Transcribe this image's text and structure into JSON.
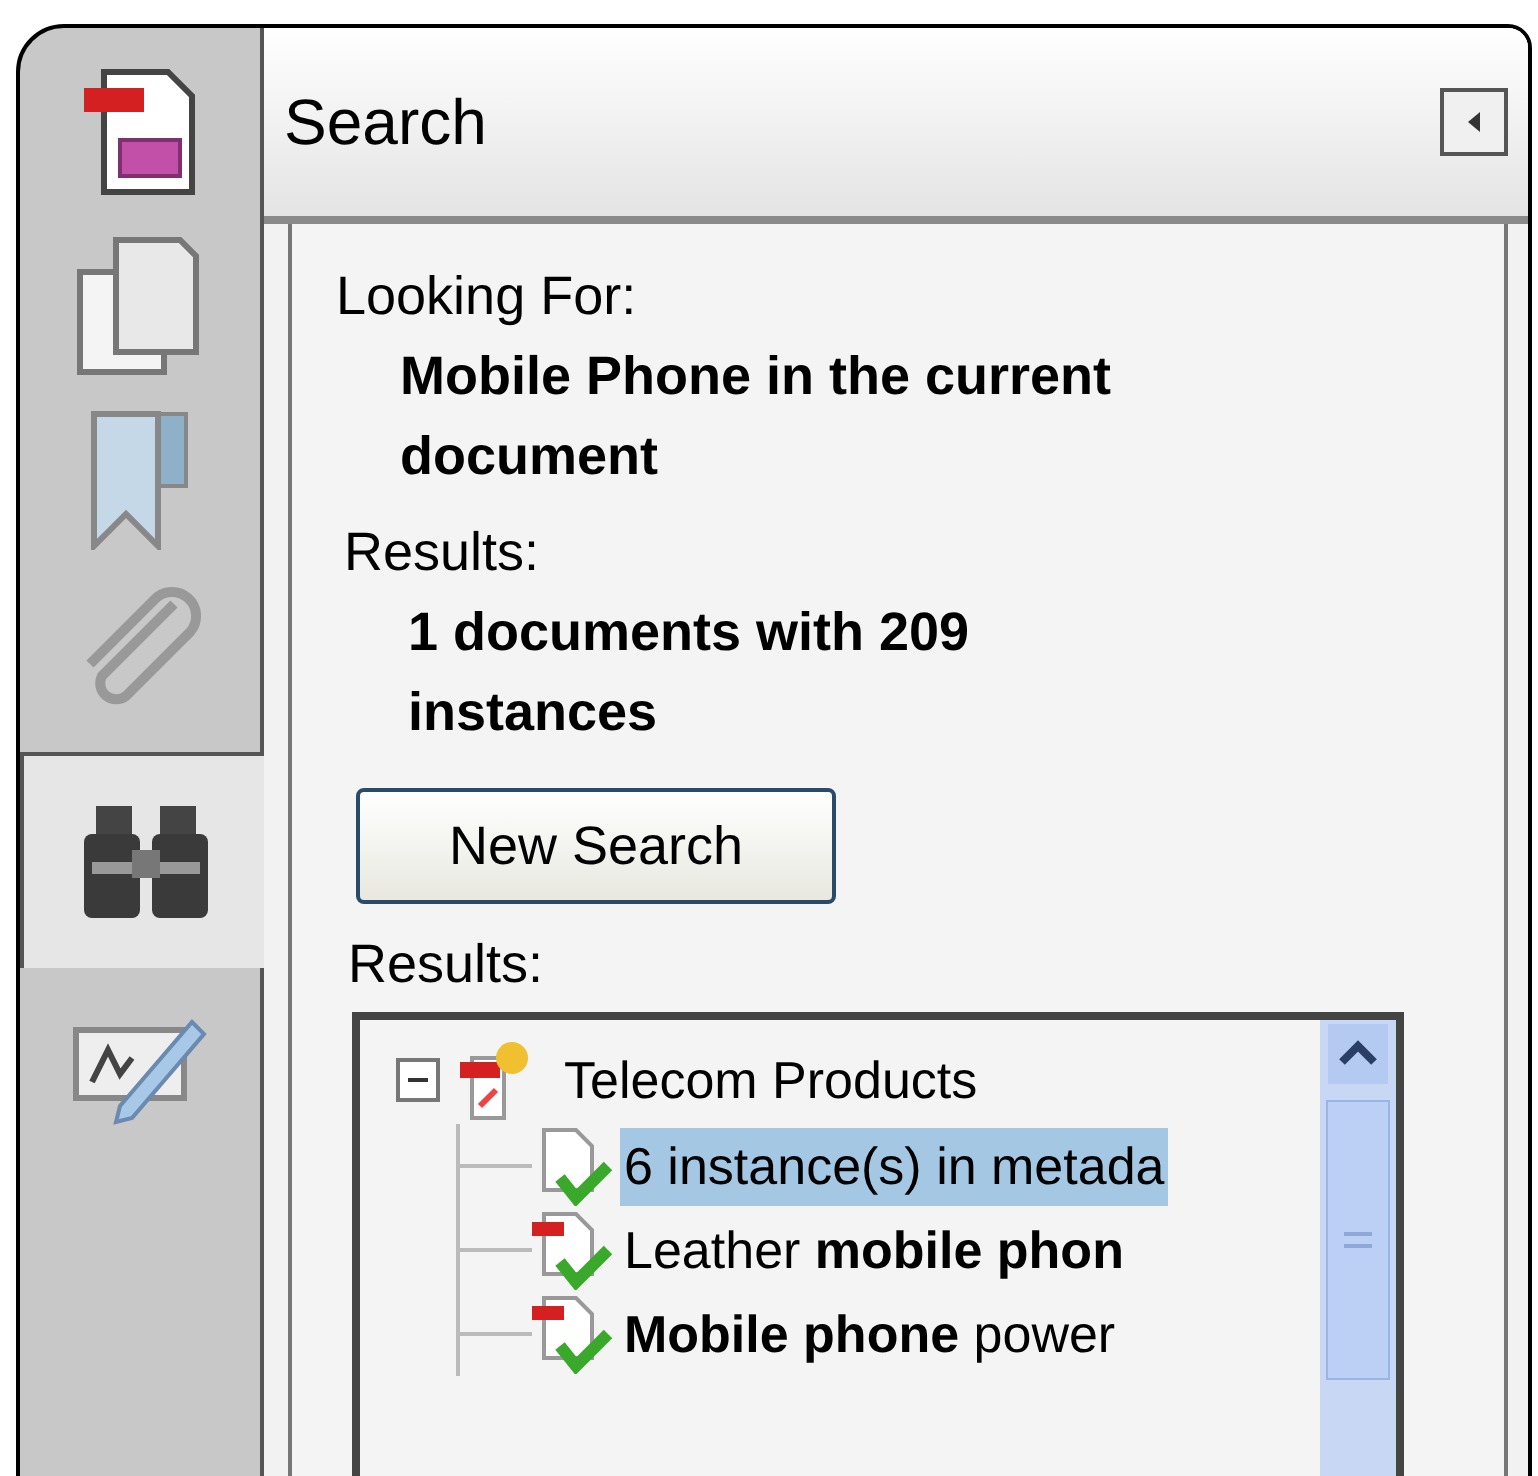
{
  "sidebar_tabs": [
    {
      "kind": "pages",
      "selected": false
    },
    {
      "kind": "copies",
      "selected": false
    },
    {
      "kind": "bookmark",
      "selected": false
    },
    {
      "kind": "attachment",
      "selected": false
    },
    {
      "kind": "search",
      "selected": true
    },
    {
      "kind": "signature",
      "selected": false
    }
  ],
  "panel": {
    "title": "Search",
    "looking_for_label": "Looking For:",
    "query": "Mobile Phone in the current document",
    "results_label": "Results:",
    "summary": "1 documents with 209 instances",
    "button": "New Search",
    "list_label": "Results:"
  },
  "tree": [
    {
      "label": "Telecom Products",
      "expanded": true,
      "children": [
        {
          "label": "6 instance(s) in metada",
          "kind": "metadata",
          "selected": true
        },
        {
          "label": "Leather **mobile phon**",
          "kind": "pdf",
          "selected": false
        },
        {
          "label": "**Mobile phone** power",
          "kind": "pdf",
          "selected": false
        }
      ]
    }
  ]
}
